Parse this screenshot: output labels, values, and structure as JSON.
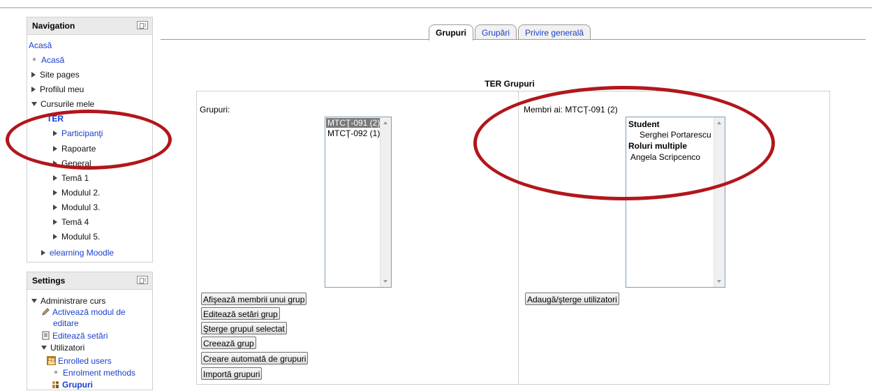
{
  "navigation": {
    "title": "Navigation",
    "home_link": "Acasă",
    "items": [
      {
        "label": "Acasă"
      },
      {
        "label": "Site pages"
      },
      {
        "label": "Profilul meu"
      },
      {
        "label": "Cursurile mele"
      },
      {
        "label": "TER"
      },
      {
        "label": "Participanţi"
      },
      {
        "label": "Rapoarte"
      },
      {
        "label": "General"
      },
      {
        "label": "Temă 1"
      },
      {
        "label": "Modulul 2."
      },
      {
        "label": "Modulul 3."
      },
      {
        "label": "Temă 4"
      },
      {
        "label": "Modulul 5."
      },
      {
        "label": "elearning Moodle"
      }
    ]
  },
  "settings": {
    "title": "Settings",
    "items": [
      {
        "label": "Administrare curs"
      },
      {
        "label": "Activează modul de"
      },
      {
        "label": "editare"
      },
      {
        "label": "Editează setări"
      },
      {
        "label": "Utilizatori"
      },
      {
        "label": "Enrolled users"
      },
      {
        "label": "Enrolment methods"
      },
      {
        "label": "Grupuri"
      }
    ]
  },
  "tabs": [
    {
      "label": "Grupuri",
      "active": true
    },
    {
      "label": "Grupări",
      "active": false
    },
    {
      "label": "Privire generală",
      "active": false
    }
  ],
  "page_title": "TER Grupuri",
  "groups_panel": {
    "label": "Grupuri:",
    "options": [
      {
        "label": "MTCŢ-091 (2)",
        "selected": true
      },
      {
        "label": "MTCŢ-092 (1)",
        "selected": false
      }
    ],
    "buttons": [
      "Afişează membrii unui grup",
      "Editează setări grup",
      "Şterge grupul selectat",
      "Creează grup",
      "Creare automată de grupuri",
      "Importă grupuri"
    ]
  },
  "members_panel": {
    "label": "Membri ai: MTCŢ-091 (2)",
    "groups": [
      {
        "role": "Student",
        "members": [
          "Serghei Portarescu"
        ]
      },
      {
        "role": "Roluri multiple",
        "members": [
          "Angela Scripcenco"
        ]
      }
    ],
    "button": "Adaugă/şterge utilizatori"
  },
  "colors": {
    "link": "#1a3fcc",
    "annotation": "#b2161c",
    "selected": "#7a7a7a"
  }
}
